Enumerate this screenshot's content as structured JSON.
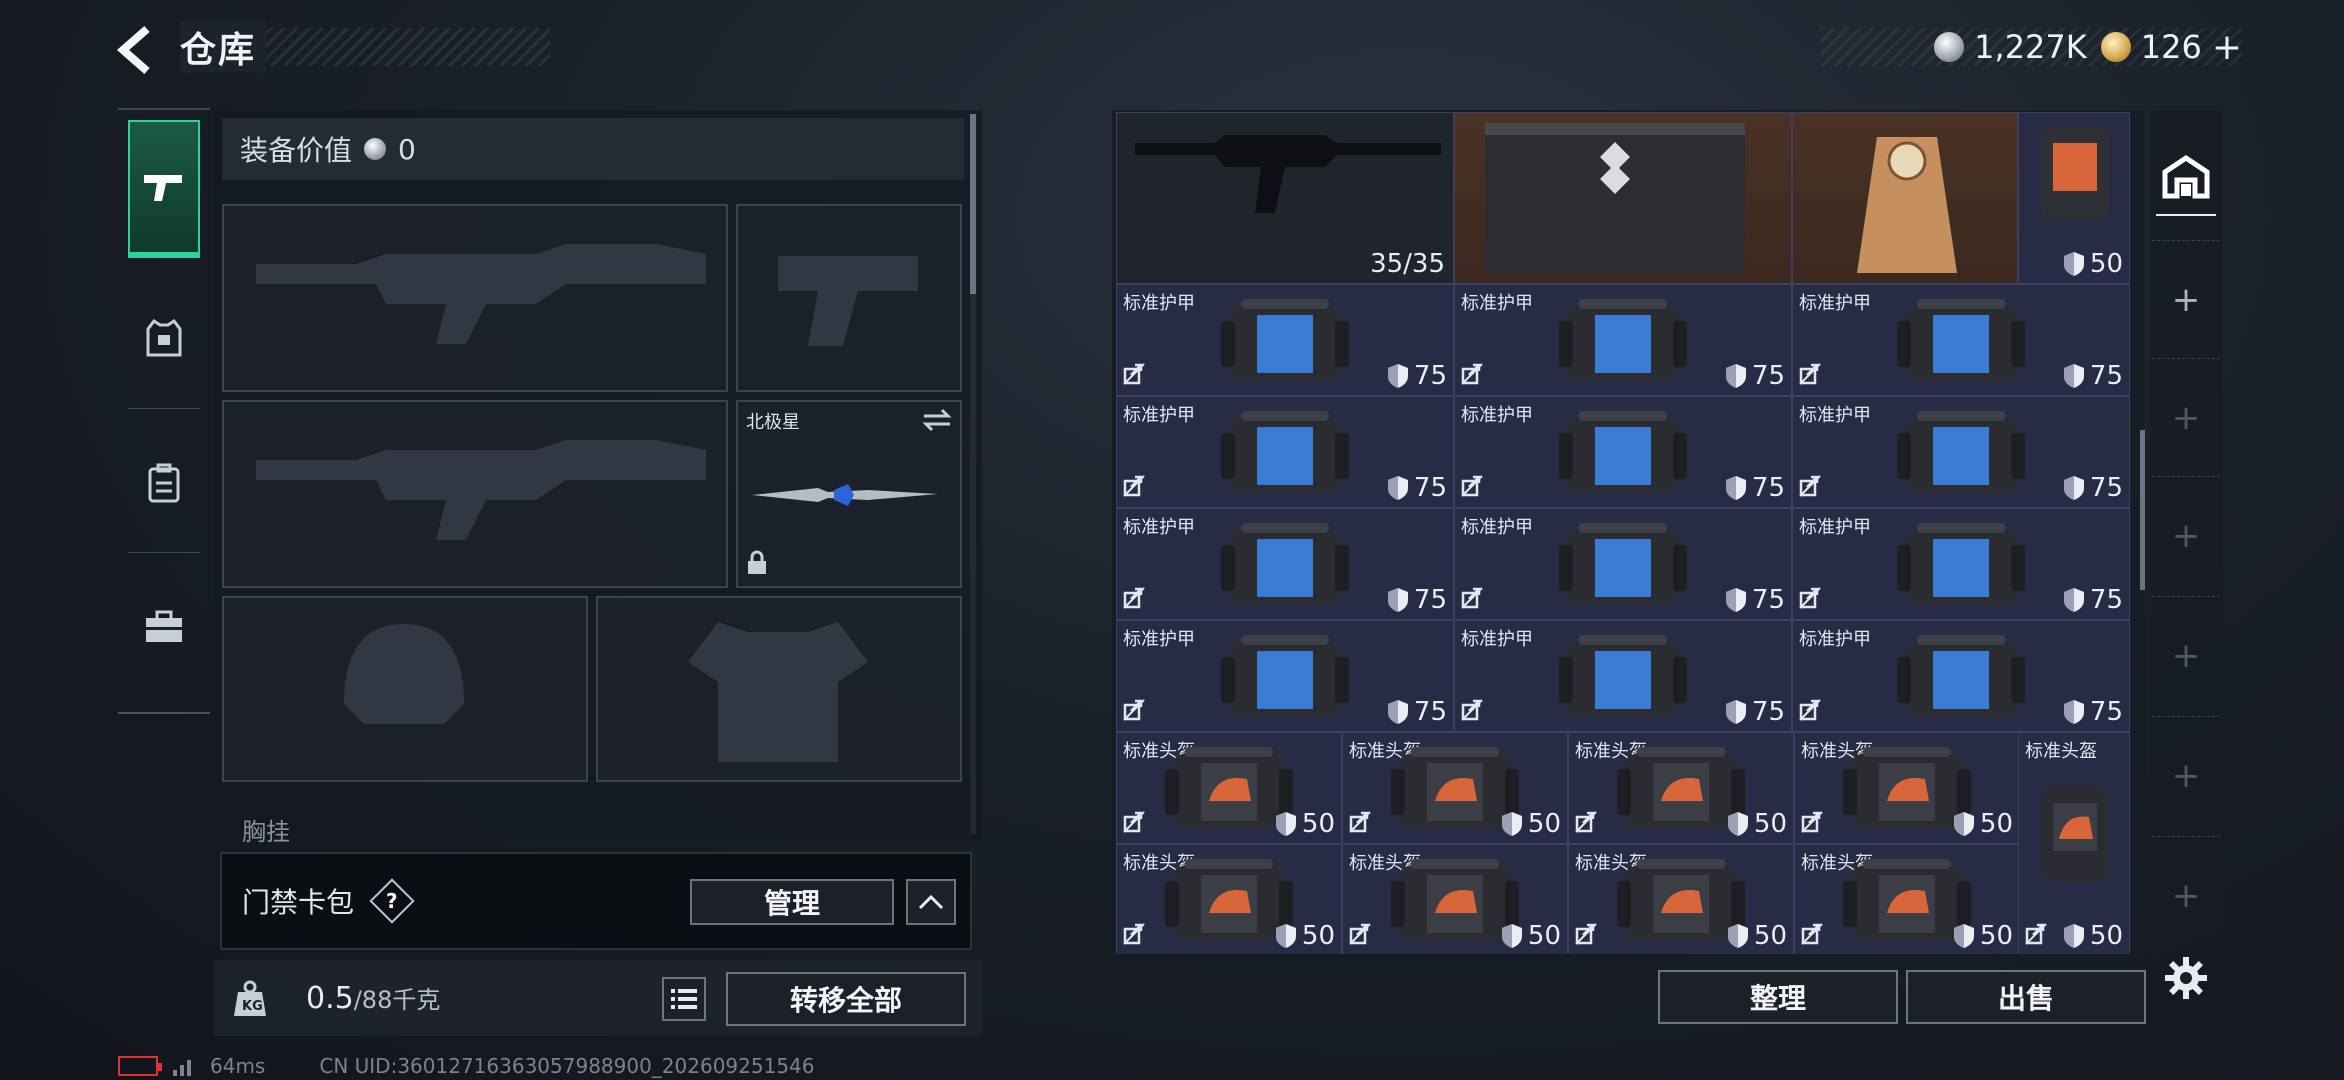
{
  "header": {
    "title": "仓库",
    "silver_amount": "1,227K",
    "gold_amount": "126",
    "add_currency": "+"
  },
  "equipment": {
    "value_label": "装备价值",
    "value": "0",
    "melee_name": "北极星",
    "partial_section": "胸挂"
  },
  "card_bag": {
    "label": "门禁卡包",
    "help": "?",
    "manage_label": "管理"
  },
  "weight": {
    "current": "0.5",
    "max": "/88千克"
  },
  "actions": {
    "transfer_all": "转移全部",
    "sort": "整理",
    "sell": "出售"
  },
  "warehouse": {
    "top_row": {
      "ammo": "35/35",
      "helmet_durability": "50"
    },
    "armor_rows": [
      [
        {
          "name": "标准护甲",
          "durability": "75"
        },
        {
          "name": "标准护甲",
          "durability": "75"
        },
        {
          "name": "标准护甲",
          "durability": "75"
        }
      ],
      [
        {
          "name": "标准护甲",
          "durability": "75"
        },
        {
          "name": "标准护甲",
          "durability": "75"
        },
        {
          "name": "标准护甲",
          "durability": "75"
        }
      ],
      [
        {
          "name": "标准护甲",
          "durability": "75"
        },
        {
          "name": "标准护甲",
          "durability": "75"
        },
        {
          "name": "标准护甲",
          "durability": "75"
        }
      ],
      [
        {
          "name": "标准护甲",
          "durability": "75"
        },
        {
          "name": "标准护甲",
          "durability": "75"
        },
        {
          "name": "标准护甲",
          "durability": "75"
        }
      ]
    ],
    "helmet_rows": [
      [
        {
          "name": "标准头盔",
          "durability": "50"
        },
        {
          "name": "标准头盔",
          "durability": "50"
        },
        {
          "name": "标准头盔",
          "durability": "50"
        },
        {
          "name": "标准头盔",
          "durability": "50"
        }
      ],
      [
        {
          "name": "标准头盔",
          "durability": "50"
        },
        {
          "name": "标准头盔",
          "durability": "50"
        },
        {
          "name": "标准头盔",
          "durability": "50"
        },
        {
          "name": "标准头盔",
          "durability": "50"
        }
      ]
    ],
    "tall_helmet": {
      "name": "标准头盔",
      "durability": "50"
    }
  },
  "status_bar": {
    "ping": "64ms",
    "uid": "CN UID:36012716363057988900_202609251546"
  },
  "colors": {
    "accent_green": "#2bd39b",
    "cell_bg": "#272b45",
    "armor_screen": "#3a7bd5",
    "helmet_accent": "#d9663a"
  }
}
